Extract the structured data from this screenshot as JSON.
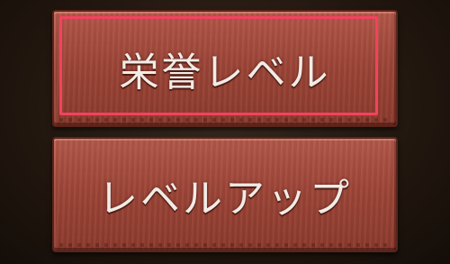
{
  "menu": {
    "buttons": [
      {
        "label": "栄誉レベル",
        "selected": true
      },
      {
        "label": "レベルアップ",
        "selected": false
      }
    ]
  },
  "colors": {
    "button_face": "#9c4538",
    "button_border": "#5a241b",
    "label_text": "#f2ebe6",
    "selection_outline": "#f3425f",
    "background": "#22170f"
  }
}
